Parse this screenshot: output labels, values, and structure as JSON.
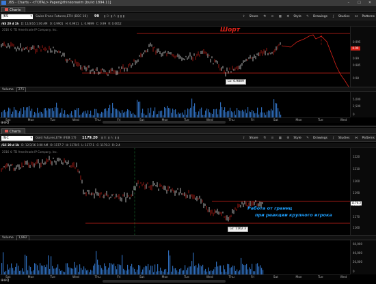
{
  "colors": {
    "window_bg": "#000000",
    "bar_color": "#ffffff",
    "down_bar": "#e0231a",
    "level_line": "#d0231a",
    "volume": "#2e6bb8",
    "blue_text": "#1ea0ff",
    "red_text": "#e0231a"
  },
  "chart1": {
    "window_title": "/6S - Charts - <TOTAL> Paper@thinkorswim [build 1894.11]",
    "tab_label": "Charts",
    "symbol": "/6S",
    "description": "Swiss Franc Futures,ETH (DEC 16)",
    "price_label": "99",
    "toolbar": {
      "share": "Share",
      "style": "Style",
      "drawings": "Drawings",
      "studies": "Studies",
      "patterns": "Patterns"
    },
    "info": {
      "timeframe": "/6S 20 d 1h",
      "date": "D: 12/3/16 1:00 AM",
      "open": "O: 0.9901",
      "high": "H: 0.9911",
      "low": "L: 0.9899",
      "close": "C: 0.99",
      "range": "R: 0.0012"
    },
    "copyright": "2016 © TD Ameritrade IP Company, Inc.",
    "annotation": "Шорт",
    "low_label": "Lo: 0.9809",
    "volume_label": "Volume",
    "volume_value": "271",
    "price_tag": "0.99",
    "price_axis": [
      "0.995",
      "0.99",
      "0.985",
      "0.98"
    ],
    "volume_axis": [
      "5,000",
      "2,500",
      "0"
    ],
    "time_axis": [
      "Sat",
      "Mon",
      "Tue",
      "Wed",
      "Thu",
      "Fri",
      "Sat",
      "Mon",
      "Tue",
      "Wed",
      "Thu",
      "Fri",
      "Sat",
      "Mon",
      "Tue",
      "Wed"
    ]
  },
  "chart2": {
    "tab_label": "Charts",
    "symbol": "/GC",
    "description": "Gold Futures,ETH (FEB 17)",
    "price_label": "1179.20",
    "toolbar": {
      "share": "Share",
      "style": "Style",
      "drawings": "Drawings",
      "studies": "Studies",
      "patterns": "Patterns"
    },
    "info": {
      "timeframe": "/GC 20 d 1h",
      "date": "D: 12/3/16 1:00 AM",
      "open": "O: 1177.7",
      "high": "H: 1179.5",
      "low": "L: 1177.1",
      "close": "C: 1179.2",
      "range": "R: 2.4"
    },
    "copyright": "2016 © TD Ameritrade IP Company, Inc.",
    "annotation_line1": "Работа от границ",
    "annotation_line2": "при реакции крупного игрока",
    "low_label": "Lo: 1162.3",
    "volume_label": "Volume",
    "volume_value": "1,882",
    "price_tag": "1179.2",
    "price_axis": [
      "1220",
      "1210",
      "1200",
      "1190",
      "1180",
      "1170",
      "1160"
    ],
    "volume_axis": [
      "60,000",
      "40,000",
      "20,000",
      "0"
    ],
    "time_axis": [
      "Sat",
      "Mon",
      "Tue",
      "Wed",
      "Thu",
      "Fri",
      "Sat",
      "Mon",
      "Tue",
      "Wed",
      "Thu",
      "Fri",
      "Sat",
      "Mon",
      "Tue",
      "Wed"
    ],
    "vertical_marker": "Nov 9"
  }
}
